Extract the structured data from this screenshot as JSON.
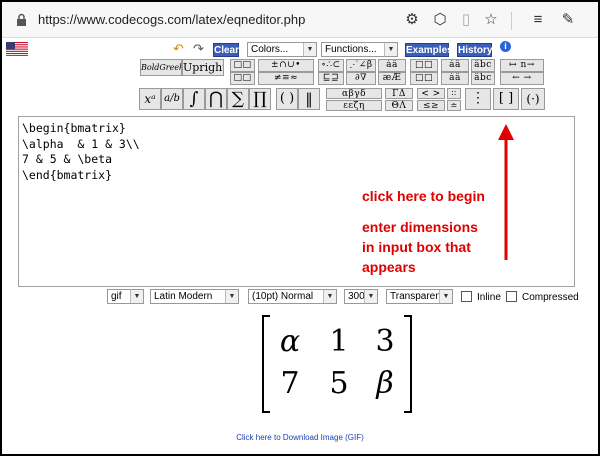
{
  "browser": {
    "url": "https://www.codecogs.com/latex/eqneditor.php",
    "icons": [
      "lock-icon",
      "puzzle-icon",
      "extension-icon",
      "reader-icon",
      "favorite-star-icon",
      "favorites-bar-icon",
      "pen-icon"
    ]
  },
  "toolbar": {
    "clear_label": "Clear",
    "colors_select": "Colors...",
    "functions_select": "Functions...",
    "examples_label": "Examples",
    "history_label": "History",
    "boldgreek_label": "BoldGreek",
    "upright_label": "Upright"
  },
  "palette": {
    "row1": [
      "□□",
      "±∩∪•",
      "∘∴⊂",
      "⋰∠β",
      "áâ",
      "□□",
      "áâ",
      "âbc",
      "↦ n→"
    ],
    "row2": [
      "□□",
      "≠≡≈",
      "⊑⊒",
      "∂∇",
      "æÆ",
      "□□",
      "áâ",
      "âbc",
      "← →"
    ],
    "row3": [
      "xᵃ",
      "a/b",
      "∫",
      "⋂",
      "∑",
      "∏",
      "( )",
      "‖",
      "αβγδ",
      "ΓΔ",
      "< >",
      "∶∶",
      "⋮",
      "[ ]",
      "(·)"
    ]
  },
  "editor": {
    "lines": [
      "\\begin{bmatrix}",
      "\\alpha  & 1 & 3\\\\",
      "7 & 5 & \\beta",
      "\\end{bmatrix}"
    ]
  },
  "annotations": {
    "click_here": "click here to begin",
    "dimensions_line1": "enter dimensions",
    "dimensions_line2": "in input box that",
    "dimensions_line3": "appears",
    "arrow_color": "#e00000"
  },
  "options": {
    "format": "gif",
    "font": "Latin Modern",
    "size": "(10pt) Normal",
    "dpi": "300",
    "background": "Transparent",
    "inline_label": "Inline",
    "compressed_label": "Compressed"
  },
  "preview": {
    "cells": [
      "α",
      "1",
      "3",
      "7",
      "5",
      "β"
    ],
    "download_link": "Click here to Download Image (GIF)"
  }
}
